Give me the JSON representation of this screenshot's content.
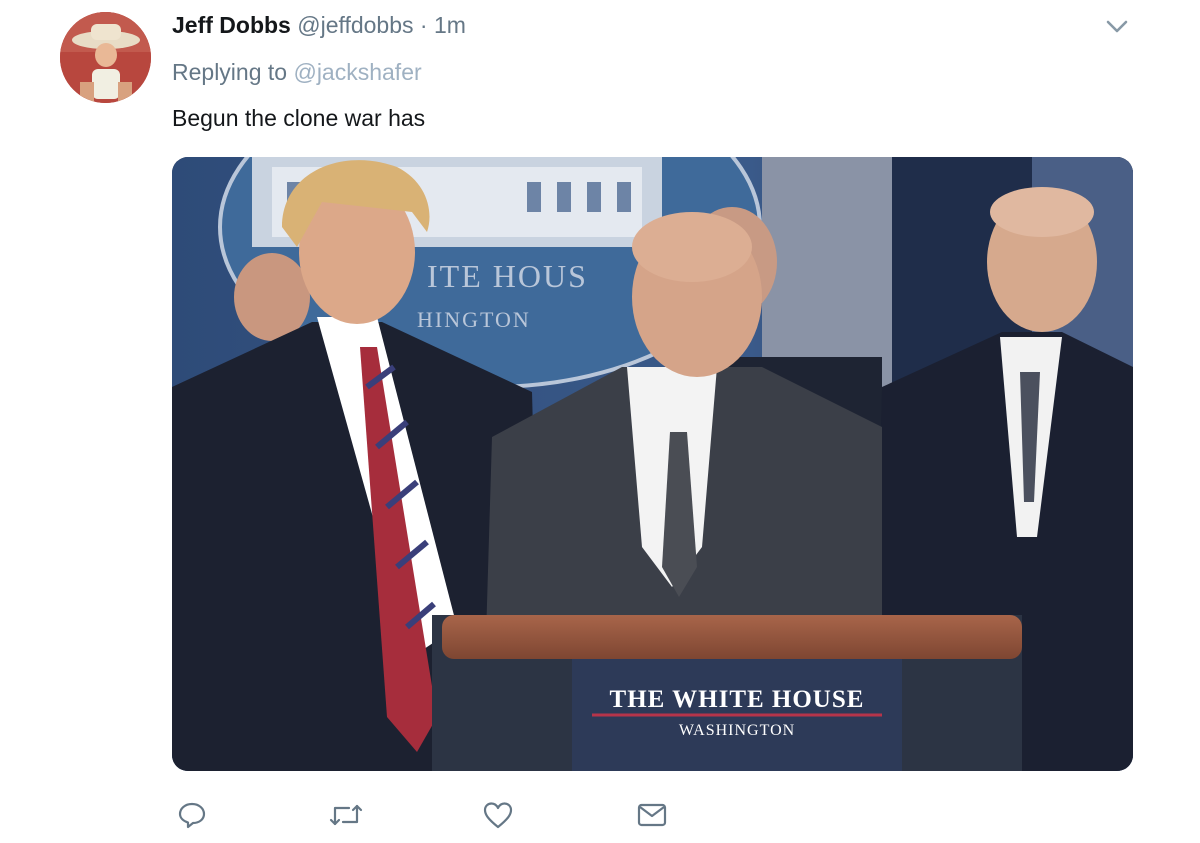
{
  "tweet": {
    "author_name": "Jeff Dobbs",
    "author_handle": "@jeffdobbs",
    "separator": "·",
    "time": "1m",
    "replying_label": "Replying to",
    "replying_to": "@jackshafer",
    "text": "Begun the clone war has"
  },
  "media": {
    "seal_text_line1": "ITE HOUS",
    "seal_text_line2": "HINGTON",
    "podium_line1": "THE WHITE HOUSE",
    "podium_line2": "WASHINGTON"
  },
  "icons": {
    "caret": "chevron-down-icon",
    "reply": "reply-icon",
    "retweet": "retweet-icon",
    "like": "heart-icon",
    "share": "envelope-icon"
  },
  "colors": {
    "name": "#14171a",
    "secondary": "#657786",
    "mention": "#9fb1c2",
    "icon": "#657786"
  }
}
